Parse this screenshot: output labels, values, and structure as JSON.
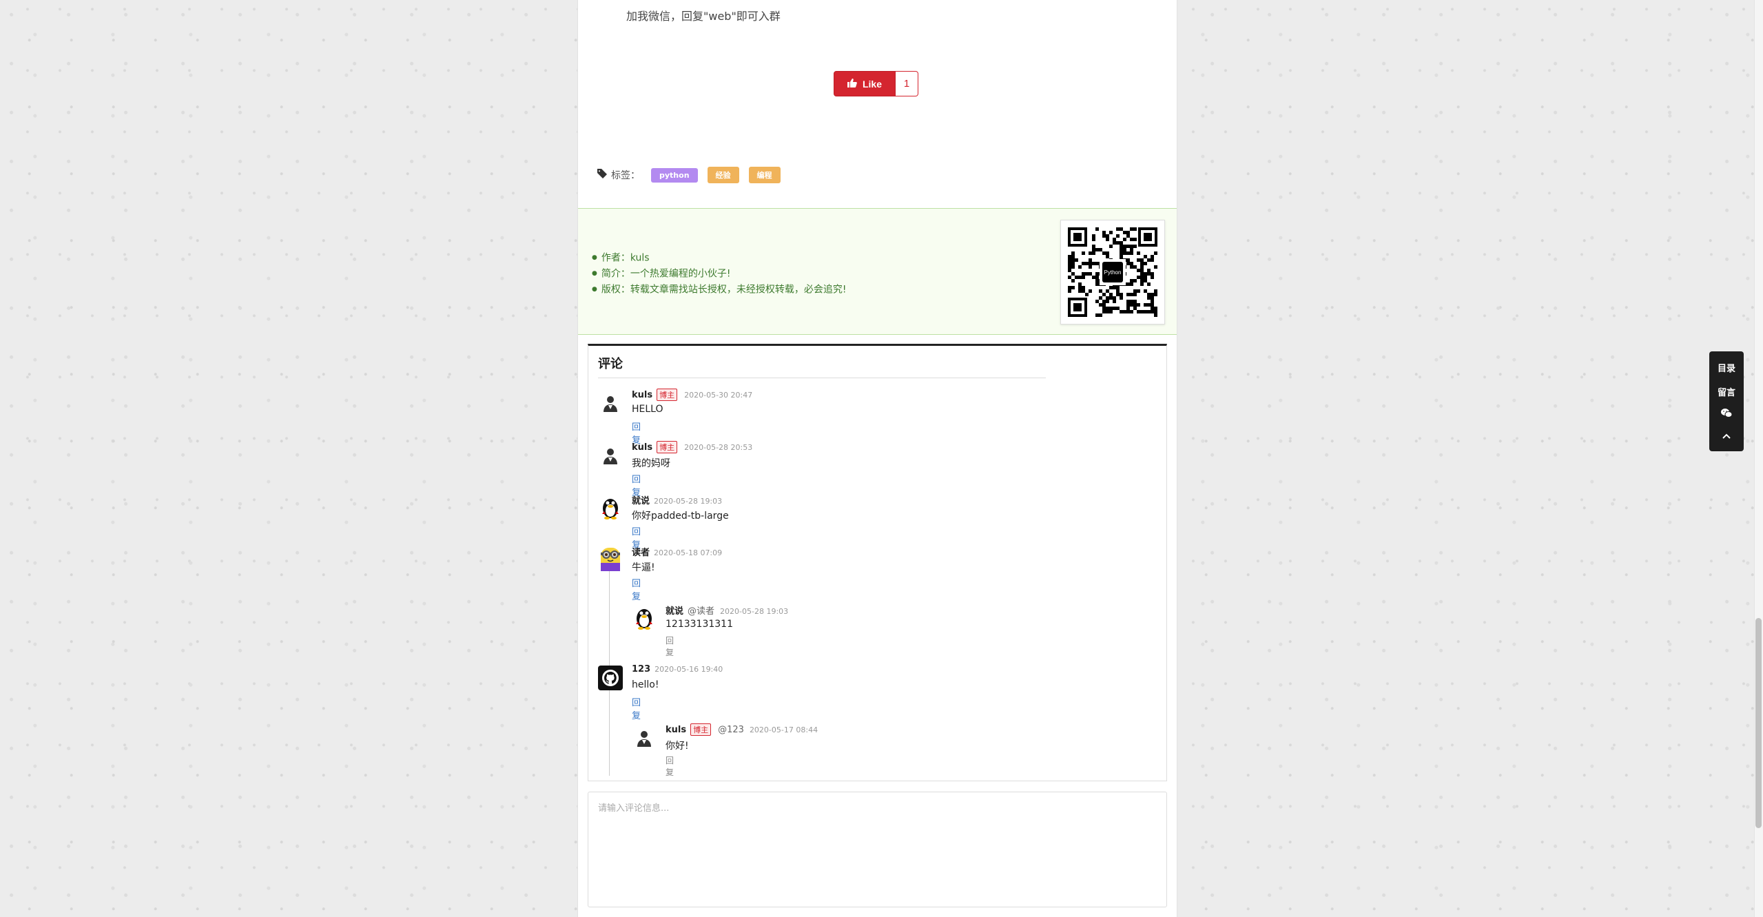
{
  "article": {
    "promo_text": "加我微信，回复\"web\"即可入群",
    "like": {
      "label": "Like",
      "count": "1"
    },
    "tags": {
      "label": "标签：",
      "items": [
        {
          "label": "python",
          "color": "#b38af0"
        },
        {
          "label": "经验",
          "color": "#f0b35a"
        },
        {
          "label": "编程",
          "color": "#f0b35a"
        }
      ]
    }
  },
  "author_box": {
    "items": [
      "作者：kuls",
      "简介：一个热爱编程的小伙子!",
      "版权：转载文章需找站长授权，未经授权转载，必会追究!"
    ],
    "qr_center_text": "Python"
  },
  "comments": {
    "title": "评论",
    "author_badge": "博主",
    "reply_label": "回复",
    "items": [
      {
        "name": "kuls",
        "badge": true,
        "time": "2020-05-30 20:47",
        "text": "HELLO"
      },
      {
        "name": "kuls",
        "badge": true,
        "time": "2020-05-28 20:53",
        "text": "我的妈呀"
      },
      {
        "name": "就说",
        "badge": false,
        "time": "2020-05-28 19:03",
        "text": "你好padded-tb-large"
      },
      {
        "name": "读者",
        "badge": false,
        "time": "2020-05-18 07:09",
        "text": "牛逼!"
      },
      {
        "name": "就说",
        "badge": false,
        "at": "@读者",
        "time": "2020-05-28 19:03",
        "text": "12133131311",
        "nested": true
      },
      {
        "name": "123",
        "badge": false,
        "time": "2020-05-16 19:40",
        "text": "hello!"
      },
      {
        "name": "kuls",
        "badge": true,
        "at": "@123",
        "time": "2020-05-17 08:44",
        "text": "你好!",
        "nested": true
      }
    ],
    "input_placeholder": "请输入评论信息..."
  },
  "side_toolbar": {
    "toc": "目录",
    "message": "留言",
    "wechat_icon": "wechat-icon",
    "top_icon": "chevron-up-icon"
  },
  "colors": {
    "like_red": "#d4252f",
    "author_green": "#3d7a2e",
    "link_blue": "#3a78c7"
  }
}
